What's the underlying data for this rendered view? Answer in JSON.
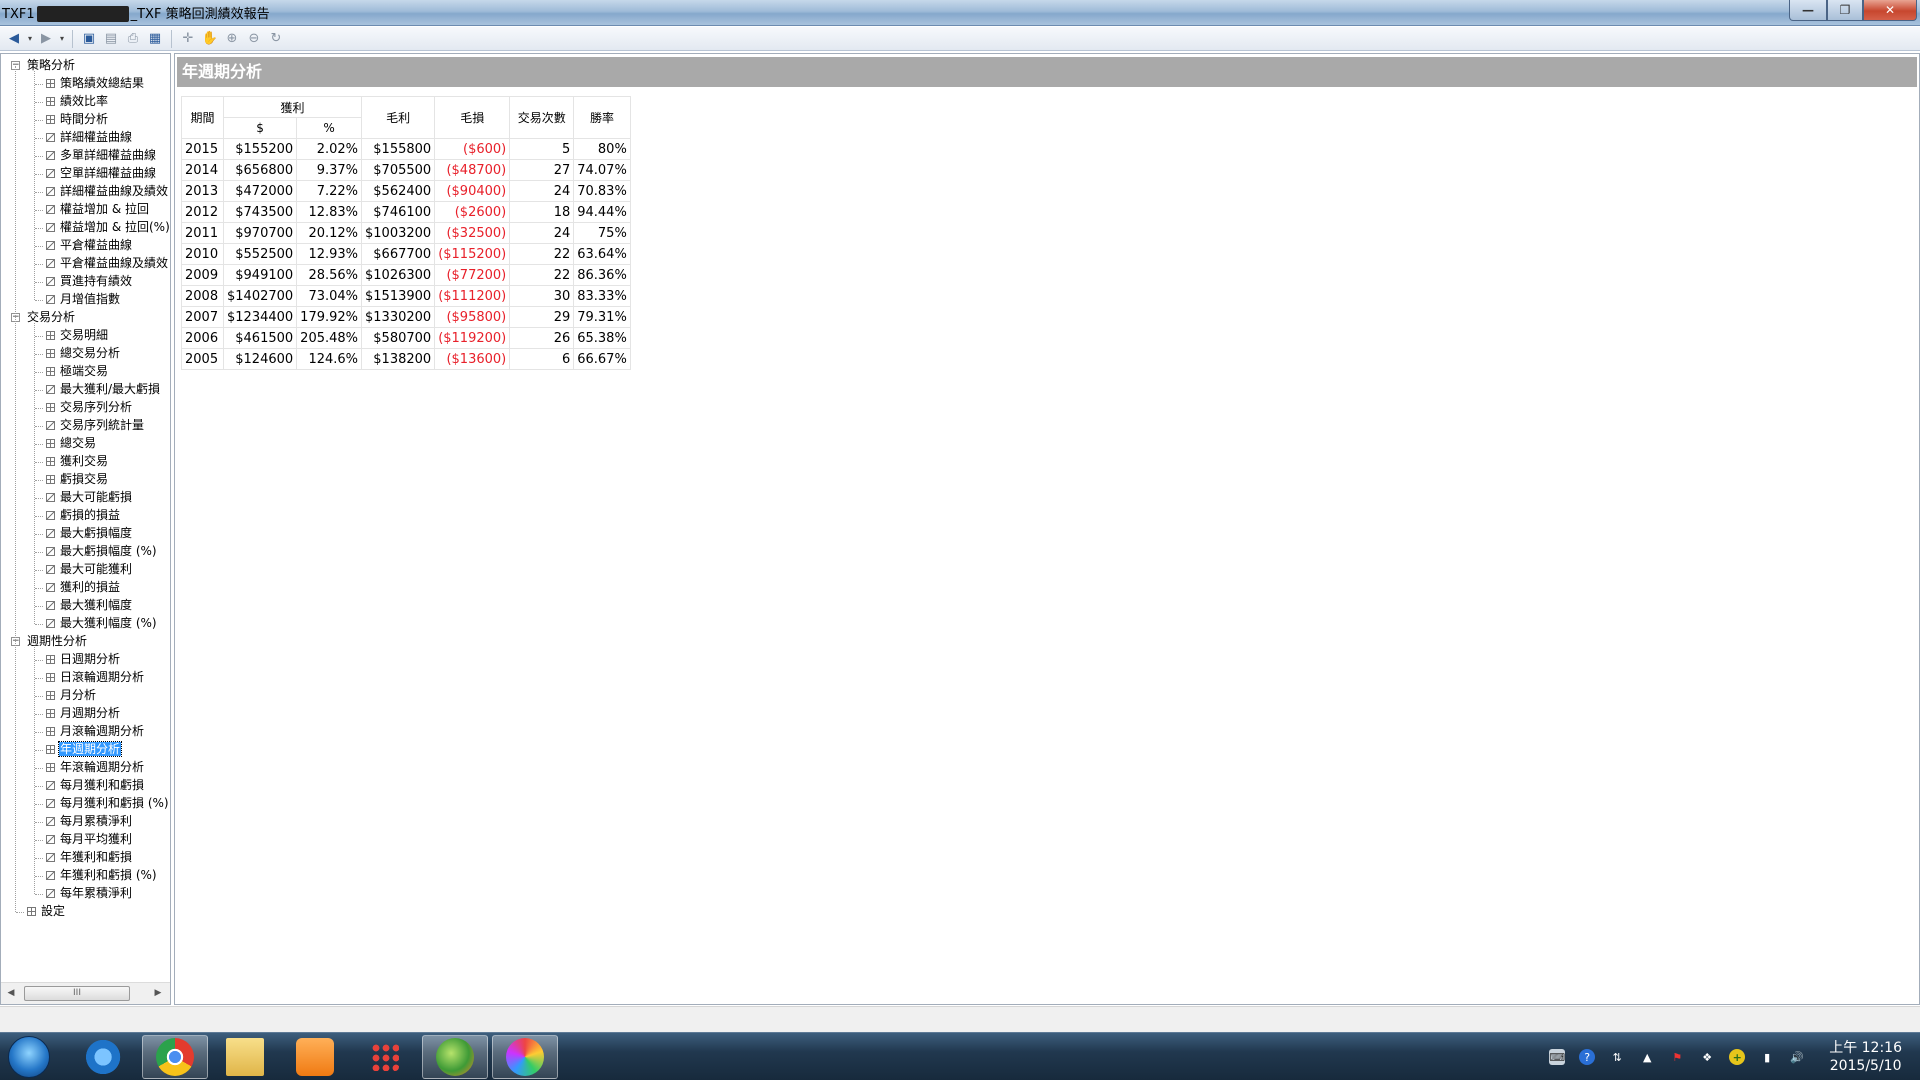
{
  "window": {
    "title_prefix": "TXF1",
    "title_suffix": "_TXF 策略回測績效報告",
    "minimize": "—",
    "maximize": "❐",
    "close": "✕"
  },
  "toolbar": {
    "icons": [
      "back-icon",
      "forward-icon",
      "save-icon",
      "page-setup-icon",
      "print-icon",
      "layout-icon",
      "move-icon",
      "hand-icon",
      "zoom-in-icon",
      "zoom-out-icon",
      "refresh-icon"
    ]
  },
  "tree": {
    "groups": [
      {
        "label": "策略分析",
        "items": [
          "策略績效總結果",
          "績效比率",
          "時間分析",
          "詳細權益曲線",
          "多單詳細權益曲線",
          "空單詳細權益曲線",
          "詳細權益曲線及績效",
          "權益增加 & 拉回",
          "權益增加 & 拉回(%)",
          "平倉權益曲線",
          "平倉權益曲線及績效",
          "買進持有績效",
          "月增值指數"
        ]
      },
      {
        "label": "交易分析",
        "items": [
          "交易明細",
          "總交易分析",
          "極端交易",
          "最大獲利/最大虧損",
          "交易序列分析",
          "交易序列統計量",
          "總交易",
          "獲利交易",
          "虧損交易",
          "最大可能虧損",
          "虧損的損益",
          "最大虧損幅度",
          "最大虧損幅度 (%)",
          "最大可能獲利",
          "獲利的損益",
          "最大獲利幅度",
          "最大獲利幅度 (%)"
        ]
      },
      {
        "label": "週期性分析",
        "items": [
          "日週期分析",
          "日滾輪週期分析",
          "月分析",
          "月週期分析",
          "月滾輪週期分析",
          "年週期分析",
          "年滾輪週期分析",
          "每月獲利和虧損",
          "每月獲利和虧損 (%)",
          "每月累積淨利",
          "每月平均獲利",
          "年獲利和虧損",
          "年獲利和虧損 (%)",
          "每年累積淨利"
        ]
      }
    ],
    "settings_label": "設定",
    "selected": "年週期分析",
    "scroll_thumb": "III"
  },
  "report": {
    "heading": "年週期分析",
    "headers": {
      "period": "期間",
      "profit": "獲利",
      "profit_amount": "$",
      "profit_pct": "%",
      "gross_profit": "毛利",
      "gross_loss": "毛損",
      "trades": "交易次數",
      "win_rate": "勝率"
    },
    "rows": [
      {
        "year": "2015",
        "profit": "$155200",
        "pct": "2.02%",
        "gross_profit": "$155800",
        "gross_loss": "($600)",
        "trades": "5",
        "win_rate": "80%"
      },
      {
        "year": "2014",
        "profit": "$656800",
        "pct": "9.37%",
        "gross_profit": "$705500",
        "gross_loss": "($48700)",
        "trades": "27",
        "win_rate": "74.07%"
      },
      {
        "year": "2013",
        "profit": "$472000",
        "pct": "7.22%",
        "gross_profit": "$562400",
        "gross_loss": "($90400)",
        "trades": "24",
        "win_rate": "70.83%"
      },
      {
        "year": "2012",
        "profit": "$743500",
        "pct": "12.83%",
        "gross_profit": "$746100",
        "gross_loss": "($2600)",
        "trades": "18",
        "win_rate": "94.44%"
      },
      {
        "year": "2011",
        "profit": "$970700",
        "pct": "20.12%",
        "gross_profit": "$1003200",
        "gross_loss": "($32500)",
        "trades": "24",
        "win_rate": "75%"
      },
      {
        "year": "2010",
        "profit": "$552500",
        "pct": "12.93%",
        "gross_profit": "$667700",
        "gross_loss": "($115200)",
        "trades": "22",
        "win_rate": "63.64%"
      },
      {
        "year": "2009",
        "profit": "$949100",
        "pct": "28.56%",
        "gross_profit": "$1026300",
        "gross_loss": "($77200)",
        "trades": "22",
        "win_rate": "86.36%"
      },
      {
        "year": "2008",
        "profit": "$1402700",
        "pct": "73.04%",
        "gross_profit": "$1513900",
        "gross_loss": "($111200)",
        "trades": "30",
        "win_rate": "83.33%"
      },
      {
        "year": "2007",
        "profit": "$1234400",
        "pct": "179.92%",
        "gross_profit": "$1330200",
        "gross_loss": "($95800)",
        "trades": "29",
        "win_rate": "79.31%"
      },
      {
        "year": "2006",
        "profit": "$461500",
        "pct": "205.48%",
        "gross_profit": "$580700",
        "gross_loss": "($119200)",
        "trades": "26",
        "win_rate": "65.38%"
      },
      {
        "year": "2005",
        "profit": "$124600",
        "pct": "124.6%",
        "gross_profit": "$138200",
        "gross_loss": "($13600)",
        "trades": "6",
        "win_rate": "66.67%"
      }
    ],
    "negative_color": "#e8202a"
  },
  "taskbar": {
    "apps": [
      "internet-explorer-icon",
      "chrome-icon",
      "file-explorer-icon",
      "media-player-icon",
      "app-grid-icon",
      "multicharts-icon",
      "paint-icon"
    ],
    "active_app": "multicharts-icon",
    "clock_time": "上午 12:16",
    "clock_date": "2015/5/10"
  }
}
